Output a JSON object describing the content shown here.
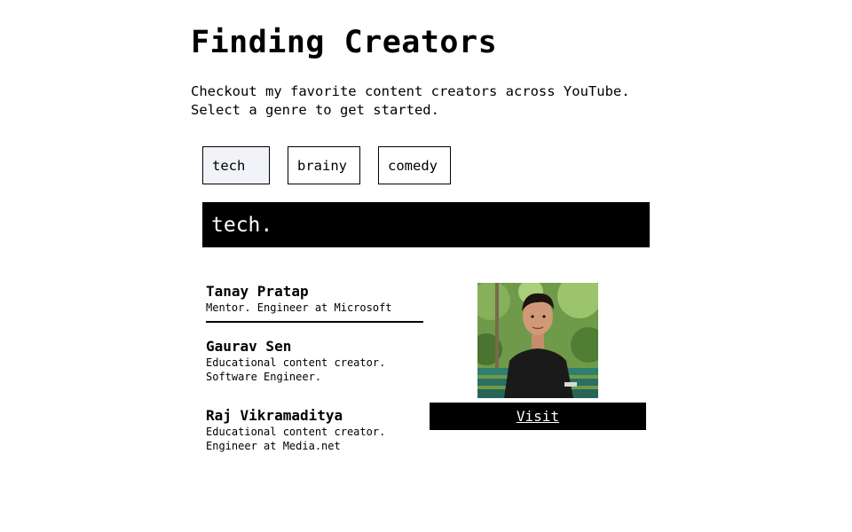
{
  "header": {
    "title": "Finding Creators",
    "intro_line1": "Checkout my favorite content creators across YouTube.",
    "intro_line2": "Select a genre to get started."
  },
  "genres": {
    "items": [
      {
        "label": "tech",
        "selected": true
      },
      {
        "label": "brainy",
        "selected": false
      },
      {
        "label": "comedy",
        "selected": false
      }
    ]
  },
  "selected_genre": {
    "banner": "tech."
  },
  "creators": [
    {
      "name": "Tanay Pratap",
      "description": "Mentor. Engineer at Microsoft"
    },
    {
      "name": "Gaurav Sen",
      "description": "Educational content creator.\nSoftware Engineer."
    },
    {
      "name": "Raj Vikramaditya",
      "description": "Educational content creator.\nEngineer at Media.net"
    }
  ],
  "preview": {
    "photo_icon": "creator-photo",
    "visit_label": "Visit"
  },
  "colors": {
    "text": "#000000",
    "background": "#ffffff",
    "selected_genre_bg": "#f1f3f8",
    "banner_bg": "#000000"
  }
}
